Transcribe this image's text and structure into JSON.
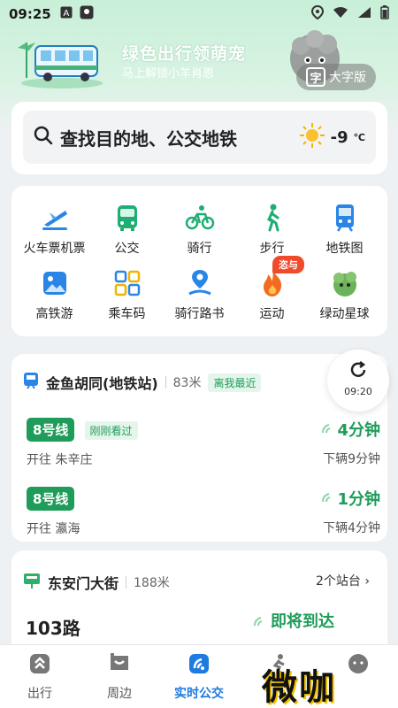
{
  "status_bar": {
    "time": "09:25"
  },
  "promo": {
    "title": "绿色出行领萌宠",
    "subtitle": "马上解锁小羊肖恩",
    "bigfont_icon": "字",
    "bigfont_label": "大字版"
  },
  "search": {
    "placeholder": "查找目的地、公交地铁",
    "temperature": "-9",
    "unit": "℃"
  },
  "grid": [
    {
      "label": "火车票机票",
      "icon": "train-plane-icon"
    },
    {
      "label": "公交",
      "icon": "bus-icon"
    },
    {
      "label": "骑行",
      "icon": "bike-icon"
    },
    {
      "label": "步行",
      "icon": "walk-icon"
    },
    {
      "label": "地铁图",
      "icon": "subway-icon"
    },
    {
      "label": "高铁游",
      "icon": "highspeed-tour-icon"
    },
    {
      "label": "乘车码",
      "icon": "qr-code-icon"
    },
    {
      "label": "骑行路书",
      "icon": "ride-route-icon"
    },
    {
      "label": "运动",
      "icon": "fire-icon"
    },
    {
      "label": "绿动星球",
      "icon": "green-planet-icon"
    }
  ],
  "hot_badge": "恣与",
  "station": {
    "name": "金鱼胡同(地铁站)",
    "distance": "83米",
    "tag": "离我最近",
    "refresh_time": "09:20",
    "lines": [
      {
        "line": "8号线",
        "note": "刚刚看过",
        "direction": "开往 朱辛庄",
        "eta": "4分钟",
        "next": "下辆9分钟"
      },
      {
        "line": "8号线",
        "note": "",
        "direction": "开往 瀛海",
        "eta": "1分钟",
        "next": "下辆4分钟"
      }
    ]
  },
  "station2": {
    "name": "东安门大街",
    "distance": "188米",
    "stops": "2个站台",
    "route": "103路",
    "status": "即将到达"
  },
  "tabs": [
    {
      "label": "出行"
    },
    {
      "label": "周边"
    },
    {
      "label": "实时公交"
    },
    {
      "label": ""
    },
    {
      "label": ""
    }
  ],
  "watermark": "微咖",
  "colors": {
    "accent_green": "#1f9c5a",
    "active_blue": "#1e7be0",
    "hot_red": "#f04a2c"
  }
}
